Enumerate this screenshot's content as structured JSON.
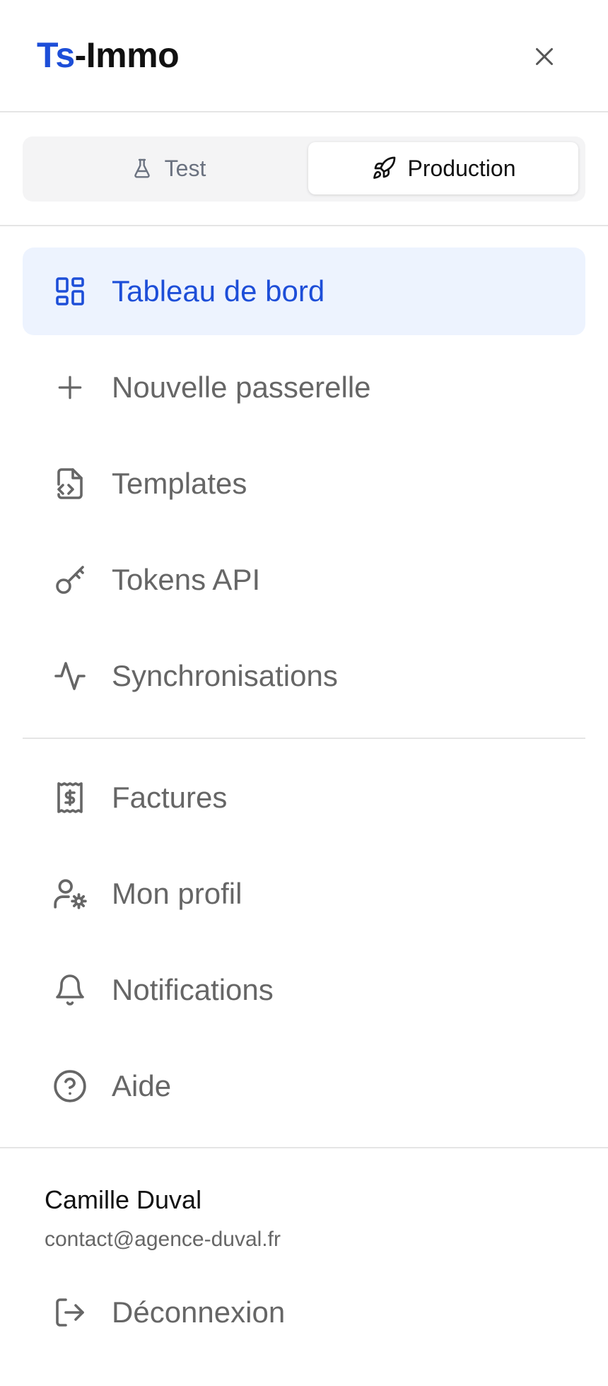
{
  "brand": {
    "prefix": "Ts",
    "suffix": "-Immo",
    "accent_color": "#1d4ed8"
  },
  "header": {
    "close_icon": "close-icon"
  },
  "environment": {
    "selected": "Production",
    "options": [
      {
        "label": "Test",
        "icon": "flask-icon"
      },
      {
        "label": "Production",
        "icon": "rocket-icon"
      }
    ]
  },
  "nav": {
    "main": [
      {
        "label": "Tableau de bord",
        "icon": "dashboard-icon",
        "active": true
      },
      {
        "label": "Nouvelle passerelle",
        "icon": "plus-icon"
      },
      {
        "label": "Templates",
        "icon": "file-code-icon"
      },
      {
        "label": "Tokens API",
        "icon": "key-icon"
      },
      {
        "label": "Synchronisations",
        "icon": "activity-icon"
      }
    ],
    "secondary": [
      {
        "label": "Factures",
        "icon": "receipt-icon"
      },
      {
        "label": "Mon profil",
        "icon": "user-settings-icon"
      },
      {
        "label": "Notifications",
        "icon": "bell-icon"
      },
      {
        "label": "Aide",
        "icon": "help-circle-icon"
      }
    ]
  },
  "user": {
    "name": "Camille Duval",
    "email": "contact@agence-duval.fr"
  },
  "logout": {
    "label": "Déconnexion",
    "icon": "logout-icon"
  },
  "colors": {
    "active_bg": "#edf3fe",
    "active_text": "#1d4ed8",
    "muted_text": "#666666",
    "divider": "#e5e5e5"
  }
}
